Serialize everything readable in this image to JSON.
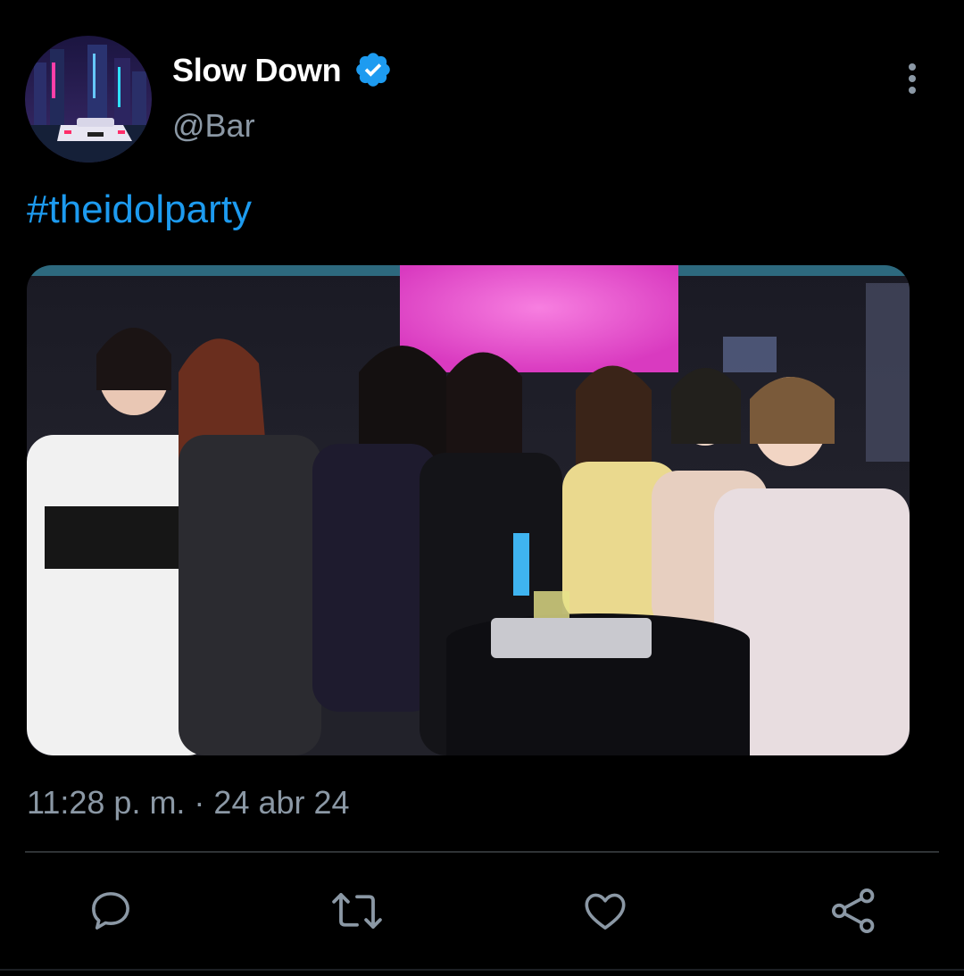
{
  "author": {
    "display_name": "Slow Down",
    "handle": "@Bar",
    "verified": true,
    "avatar": "night-city-car-avatar"
  },
  "tweet": {
    "text": "#theidolparty",
    "timestamp": "11:28 p. m. · 24 abr 24",
    "media": "group-photo-party"
  },
  "actions": [
    {
      "icon": "reply-icon"
    },
    {
      "icon": "retweet-icon"
    },
    {
      "icon": "like-icon"
    },
    {
      "icon": "share-icon"
    }
  ],
  "colors": {
    "background": "#000000",
    "accent": "#1d9bf0",
    "secondary_text": "#8b98a5",
    "primary_text": "#ffffff"
  }
}
